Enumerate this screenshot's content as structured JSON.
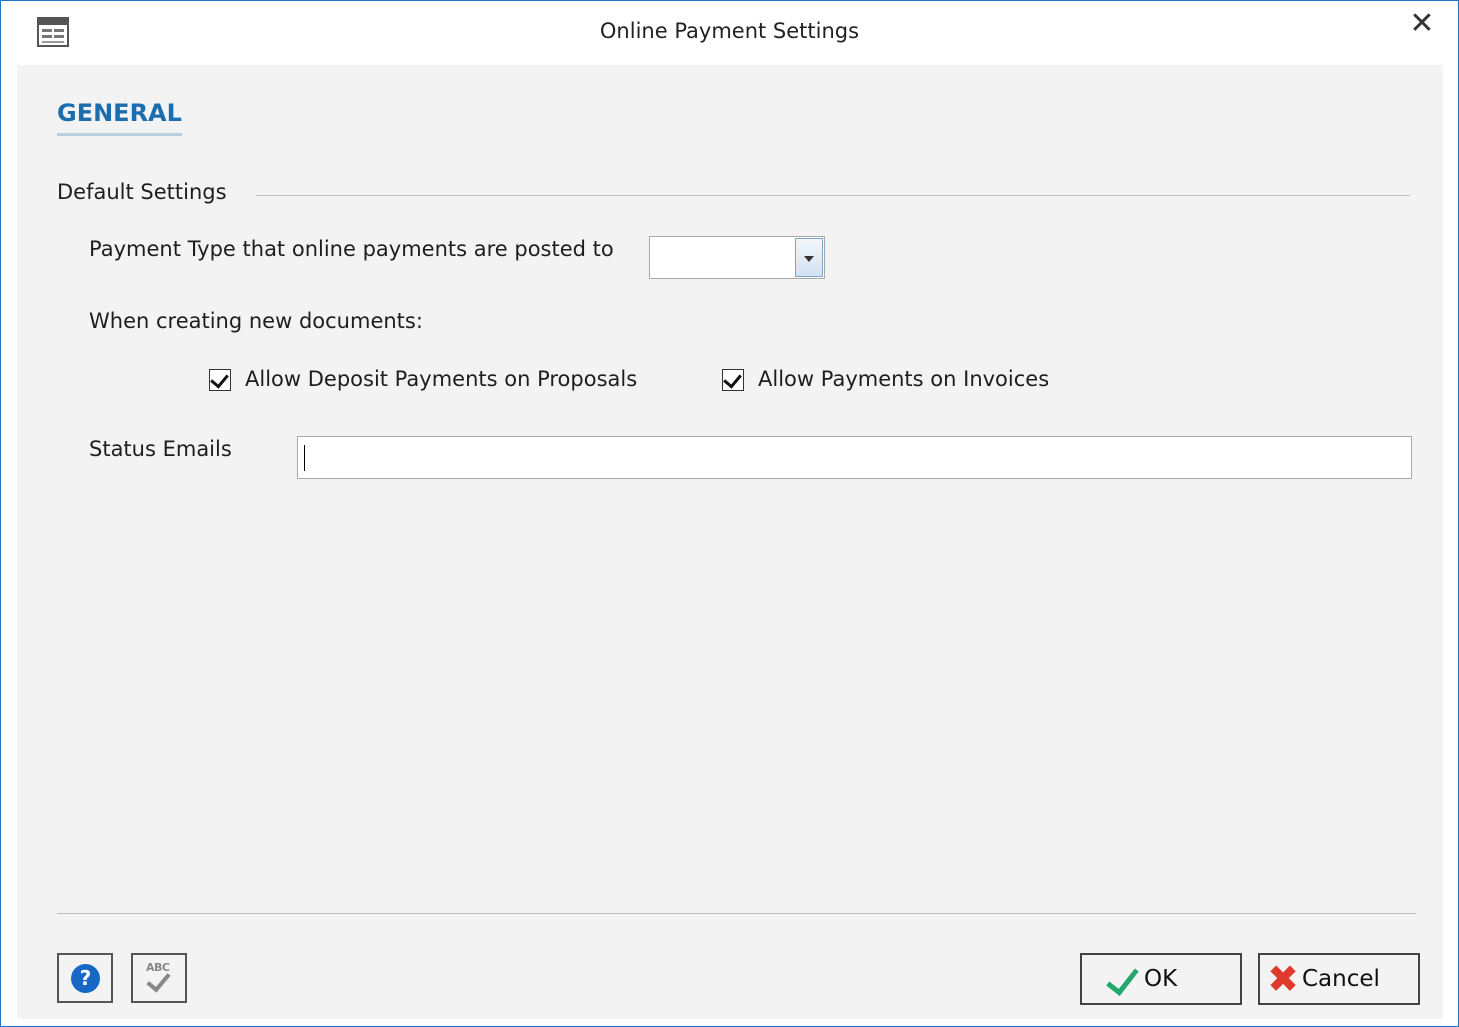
{
  "window": {
    "title": "Online Payment Settings",
    "close_glyph": "✕",
    "icon": "window-form-icon"
  },
  "tabs": [
    {
      "label": "GENERAL",
      "active": true
    }
  ],
  "default_settings": {
    "section_title": "Default Settings",
    "payment_type_label": "Payment Type that online payments are posted to",
    "payment_type_value": "",
    "new_docs_label": "When creating new documents:",
    "allow_deposit_label": "Allow Deposit Payments on Proposals",
    "allow_deposit_checked": true,
    "allow_invoice_label": "Allow Payments on Invoices",
    "allow_invoice_checked": true,
    "status_emails_label": "Status Emails",
    "status_emails_value": ""
  },
  "footer": {
    "help_glyph": "?",
    "spellcheck_glyph": "ABC",
    "ok_label": "OK",
    "cancel_glyph": "✖",
    "cancel_label": "Cancel"
  },
  "colors": {
    "accent": "#1a6eb0",
    "window_border": "#1c74c4",
    "ok_check": "#22a86c",
    "cancel_x": "#e03a2e",
    "help_blue": "#1768c4"
  }
}
